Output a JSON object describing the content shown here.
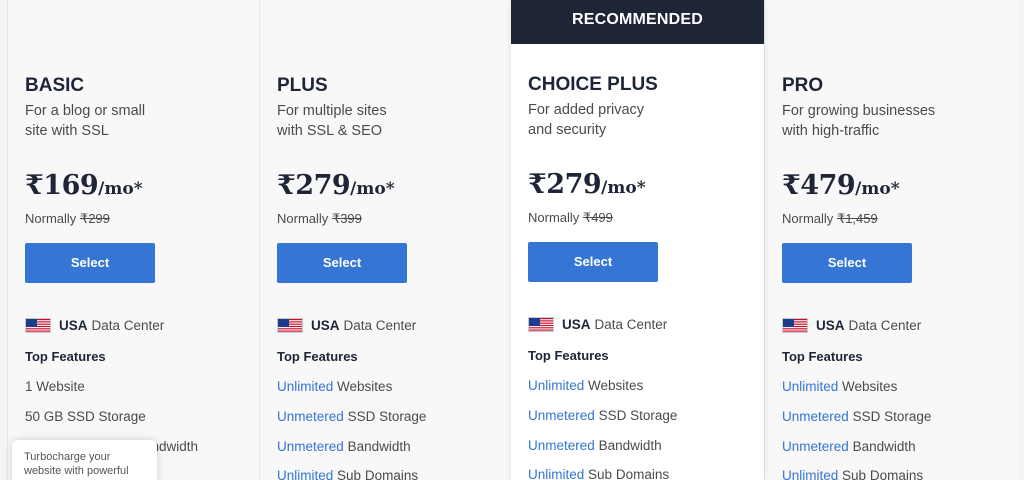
{
  "recommended_banner": "RECOMMENDED",
  "colors": {
    "accent": "#3575d3",
    "dark": "#1d2537",
    "banner": "#1d2537"
  },
  "plans": [
    {
      "name": "BASIC",
      "desc1": "For a blog or small",
      "desc2": "site with SSL",
      "price": "₹169",
      "per": "/mo*",
      "normally_label": "Normally",
      "old_price": "₹299",
      "select_label": "Select",
      "dc_bold": "USA",
      "dc_rest": "Data Center",
      "top_features": "Top Features",
      "features": [
        {
          "hl": "",
          "rest": "1 Website"
        },
        {
          "hl": "",
          "rest": "50 GB SSD Storage"
        },
        {
          "hl": "",
          "rest": "Bandwidth"
        }
      ]
    },
    {
      "name": "PLUS",
      "desc1": "For multiple sites",
      "desc2": "with SSL & SEO",
      "price": "₹279",
      "per": "/mo*",
      "normally_label": "Normally",
      "old_price": "₹399",
      "select_label": "Select",
      "dc_bold": "USA",
      "dc_rest": "Data Center",
      "top_features": "Top Features",
      "features": [
        {
          "hl": "Unlimited",
          "rest": "Websites"
        },
        {
          "hl": "Unmetered",
          "rest": "SSD Storage"
        },
        {
          "hl": "Unmetered",
          "rest": "Bandwidth"
        },
        {
          "hl": "Unlimited",
          "rest": "Sub Domains"
        }
      ]
    },
    {
      "name": "CHOICE PLUS",
      "desc1": "For added privacy",
      "desc2": "and security",
      "price": "₹279",
      "per": "/mo*",
      "normally_label": "Normally",
      "old_price": "₹499",
      "select_label": "Select",
      "dc_bold": "USA",
      "dc_rest": "Data Center",
      "top_features": "Top Features",
      "features": [
        {
          "hl": "Unlimited",
          "rest": "Websites"
        },
        {
          "hl": "Unmetered",
          "rest": "SSD Storage"
        },
        {
          "hl": "Unmetered",
          "rest": "Bandwidth"
        },
        {
          "hl": "Unlimited",
          "rest": "Sub Domains"
        }
      ]
    },
    {
      "name": "PRO",
      "desc1": "For growing businesses",
      "desc2": "with high-traffic",
      "price": "₹479",
      "per": "/mo*",
      "normally_label": "Normally",
      "old_price": "₹1,459",
      "select_label": "Select",
      "dc_bold": "USA",
      "dc_rest": "Data Center",
      "top_features": "Top Features",
      "features": [
        {
          "hl": "Unlimited",
          "rest": "Websites"
        },
        {
          "hl": "Unmetered",
          "rest": "SSD Storage"
        },
        {
          "hl": "Unmetered",
          "rest": "Bandwidth"
        },
        {
          "hl": "Unlimited",
          "rest": "Sub Domains"
        }
      ]
    }
  ],
  "tooltip": {
    "line1": "Turbocharge your",
    "line2": "website with powerful"
  }
}
